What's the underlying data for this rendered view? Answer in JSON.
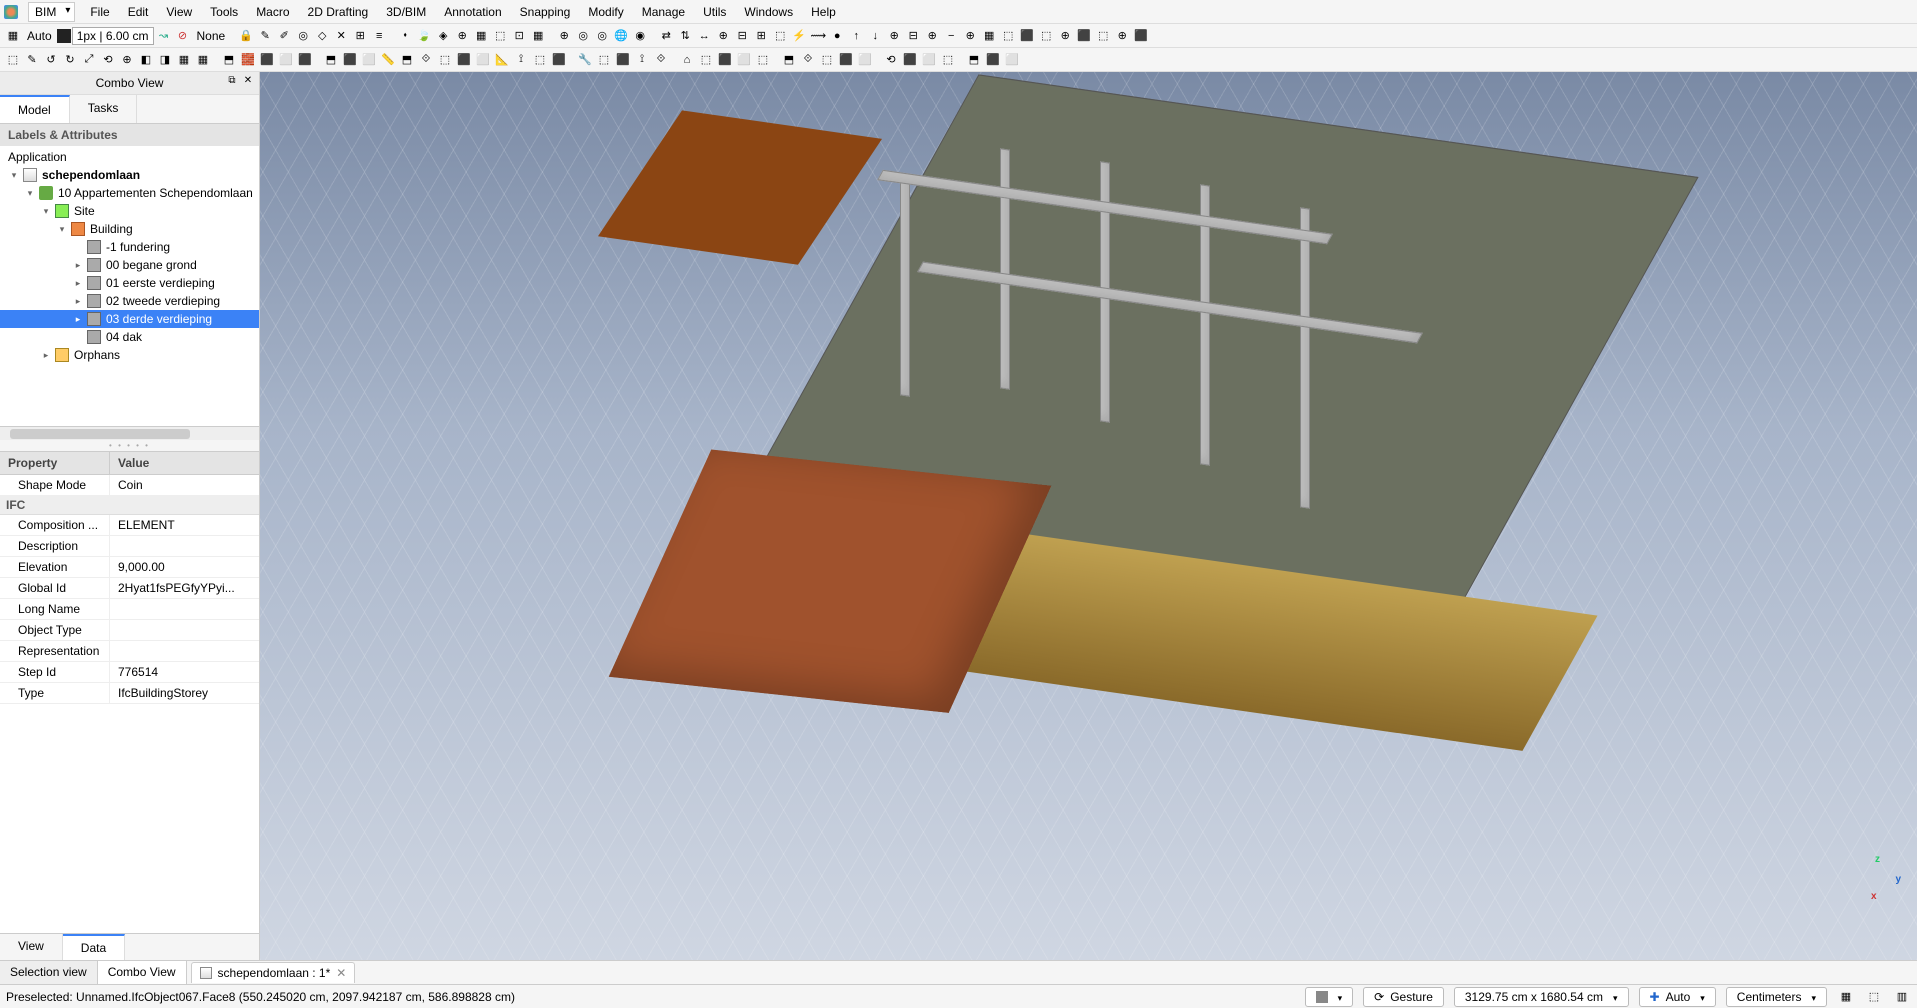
{
  "workbench": "BIM",
  "menus": [
    "File",
    "Edit",
    "View",
    "Tools",
    "Macro",
    "2D Drafting",
    "3D/BIM",
    "Annotation",
    "Snapping",
    "Modify",
    "Manage",
    "Utils",
    "Windows",
    "Help"
  ],
  "toolbar1": {
    "auto": "Auto",
    "linewidth": "1px | 6.00 cm",
    "none": "None"
  },
  "combo_view": {
    "title": "Combo View",
    "tabs": [
      "Model",
      "Tasks"
    ],
    "active_tab": 0,
    "section": "Labels & Attributes",
    "bottom_tabs": [
      "View",
      "Data"
    ],
    "active_bottom": 1
  },
  "tree": {
    "root": "Application",
    "doc": "schependomlaan",
    "items": [
      {
        "depth": 0,
        "twisty": "▾",
        "icon": "ic-doc",
        "label": "schependomlaan",
        "bold": true
      },
      {
        "depth": 1,
        "twisty": "▾",
        "icon": "ic-grp",
        "label": "10 Appartementen Schependomlaan"
      },
      {
        "depth": 2,
        "twisty": "▾",
        "icon": "ic-site",
        "label": "Site"
      },
      {
        "depth": 3,
        "twisty": "▾",
        "icon": "ic-bld",
        "label": "Building"
      },
      {
        "depth": 4,
        "twisty": "",
        "icon": "ic-lvl",
        "label": "-1 fundering"
      },
      {
        "depth": 4,
        "twisty": "▸",
        "icon": "ic-lvl",
        "label": "00 begane grond"
      },
      {
        "depth": 4,
        "twisty": "▸",
        "icon": "ic-lvl",
        "label": "01 eerste verdieping"
      },
      {
        "depth": 4,
        "twisty": "▸",
        "icon": "ic-lvl",
        "label": "02 tweede verdieping"
      },
      {
        "depth": 4,
        "twisty": "▸",
        "icon": "ic-lvl",
        "label": "03 derde verdieping",
        "selected": true
      },
      {
        "depth": 4,
        "twisty": "",
        "icon": "ic-lvl",
        "label": "04 dak"
      },
      {
        "depth": 2,
        "twisty": "▸",
        "icon": "ic-fld",
        "label": "Orphans"
      }
    ]
  },
  "props": {
    "headers": [
      "Property",
      "Value"
    ],
    "rows_pre": [
      {
        "k": "Shape Mode",
        "v": "Coin"
      }
    ],
    "group": "IFC",
    "rows": [
      {
        "k": "Composition ...",
        "v": "ELEMENT"
      },
      {
        "k": "Description",
        "v": ""
      },
      {
        "k": "Elevation",
        "v": "9,000.00"
      },
      {
        "k": "Global Id",
        "v": "2Hyat1fsPEGfyYPyi..."
      },
      {
        "k": "Long Name",
        "v": ""
      },
      {
        "k": "Object Type",
        "v": ""
      },
      {
        "k": "Representation",
        "v": ""
      },
      {
        "k": "Step Id",
        "v": "776514"
      },
      {
        "k": "Type",
        "v": "IfcBuildingStorey"
      }
    ]
  },
  "side_tabs": [
    "Selection view",
    "Combo View"
  ],
  "active_side_tab": 1,
  "doc_tab": "schependomlaan : 1*",
  "status": {
    "left": "Preselected: Unnamed.IfcObject067.Face8 (550.245020 cm, 2097.942187 cm, 586.898828 cm)",
    "nav": "Gesture",
    "dims": "3129.75 cm x 1680.54 cm",
    "auto": "Auto",
    "units": "Centimeters"
  },
  "icons_row2": [
    "⬚",
    "✎",
    "↺",
    "↻",
    "⤢",
    "⟲",
    "⊕",
    "◧",
    "◨",
    "▦",
    "▦",
    "|",
    "⬒",
    "🧱",
    "⬛",
    "⬜",
    "⬛",
    "|",
    "⬒",
    "⬛",
    "⬜",
    "📏",
    "⬒",
    "⟐",
    "⬚",
    "⬛",
    "⬜",
    "📐",
    "⟟",
    "⬚",
    "⬛",
    "|",
    "🔧",
    "⬚",
    "⬛",
    "⟟",
    "⟐",
    "|",
    "⌂",
    "⬚",
    "⬛",
    "⬜",
    "⬚",
    "|",
    "⬒",
    "⟐",
    "⬚",
    "⬛",
    "⬜",
    "|",
    "⟲",
    "⬛",
    "⬜",
    "⬚",
    "|",
    "⬒",
    "⬛",
    "⬜"
  ],
  "icons_row1b": [
    "🔒",
    "✎",
    "✐",
    "◎",
    "◇",
    "✕",
    "⊞",
    "≡",
    "|",
    "⬪",
    "🍃",
    "◈",
    "⊕",
    "▦",
    "⬚",
    "⊡",
    "▦",
    "|",
    "⊕",
    "◎",
    "◎",
    "🌐",
    "◉",
    "|",
    "⇄",
    "⇅",
    "↔",
    "⊕",
    "⊟",
    "⊞",
    "⬚",
    "⚡",
    "⟿",
    "●",
    "↑",
    "↓",
    "⊕",
    "⊟",
    "⊕",
    "−",
    "⊕",
    "▦",
    "⬚",
    "⬛",
    "⬚",
    "⊕",
    "⬛",
    "⬚",
    "⊕",
    "⬛"
  ]
}
